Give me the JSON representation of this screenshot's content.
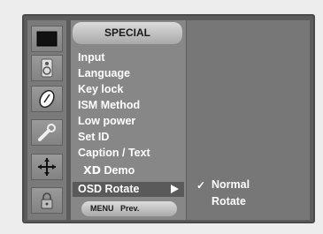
{
  "menu": {
    "title": "SPECIAL",
    "items": [
      {
        "label": "Input"
      },
      {
        "label": "Language"
      },
      {
        "label": "Key lock"
      },
      {
        "label": "ISM Method"
      },
      {
        "label": "Low power"
      },
      {
        "label": "Set ID"
      },
      {
        "label": "Caption / Text"
      },
      {
        "label": "Demo",
        "prefix": "XD"
      },
      {
        "label": "OSD Rotate",
        "selected": true
      }
    ]
  },
  "footer": {
    "menu_key": "MENU",
    "prev_label": "Prev."
  },
  "submenu": {
    "items": [
      {
        "label": "Normal",
        "checked": true
      },
      {
        "label": "Rotate",
        "checked": false
      }
    ],
    "check_glyph": "✓"
  },
  "icons": [
    "picture-icon",
    "speaker-icon",
    "clock-icon",
    "wrench-icon",
    "move-icon",
    "lock-icon"
  ],
  "colors": {
    "frame": "#5c5c5c",
    "menu_bg": "#878787",
    "selected_bg": "#5a5a5a",
    "submenu_bg": "#777777",
    "text": "#ffffff"
  }
}
